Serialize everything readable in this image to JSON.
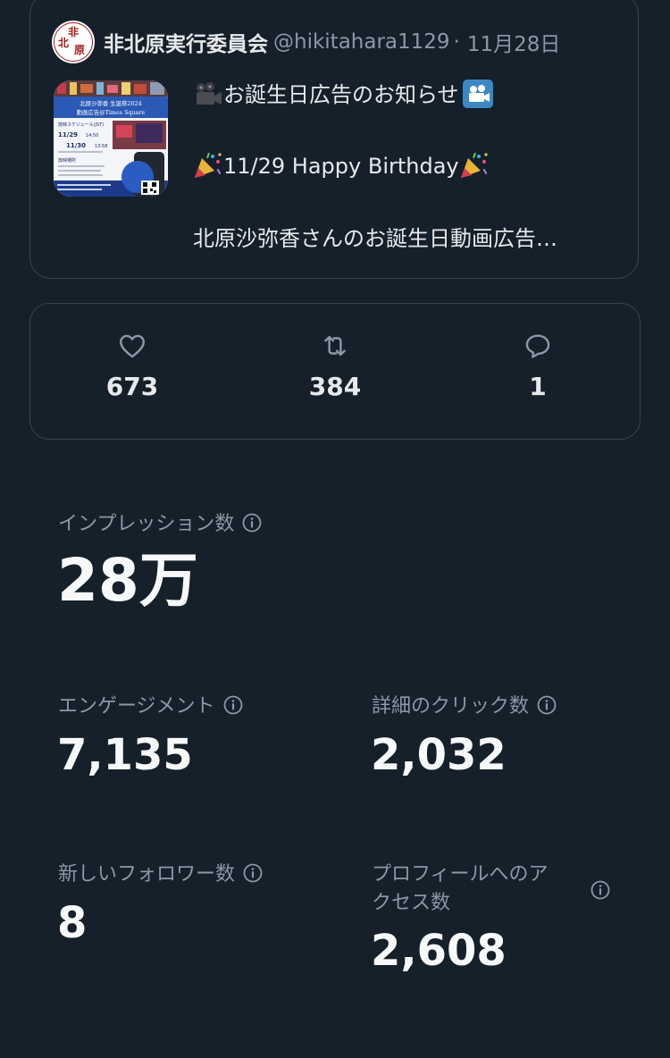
{
  "tweet": {
    "display_name": "非北原実行委員会",
    "handle": "@hikitahara1129",
    "separator": "·",
    "date": "11月28日",
    "avatar_glyphs": [
      "非",
      "北",
      "原"
    ],
    "line1": "お誕生日広告のお知らせ",
    "line2": "11/29 Happy Birthday",
    "line3": "北原沙弥香さんのお誕生日動画広告…",
    "media": {
      "banner_line1": "北原沙弥香 生誕祭2024",
      "banner_line2": "動画広告@Times Square",
      "schedule_title": "放映スケジュール(JST)",
      "date1": "11/29",
      "time1": "14:50",
      "date2": "11/30",
      "time2": "13:58",
      "venue_title": "放映場所"
    }
  },
  "metrics": {
    "likes": "673",
    "retweets": "384",
    "replies": "1"
  },
  "stats": {
    "impressions_label": "インプレッション数",
    "impressions_value": "28万",
    "engagement_label": "エンゲージメント",
    "engagement_value": "7,135",
    "detail_clicks_label": "詳細のクリック数",
    "detail_clicks_value": "2,032",
    "new_followers_label": "新しいフォロワー数",
    "new_followers_value": "8",
    "profile_visits_label_line1": "プロフィールへのア",
    "profile_visits_label_line2": "クセス数",
    "profile_visits_value": "2,608"
  },
  "colors": {
    "background": "#15202b",
    "border": "#38444d",
    "text_primary": "#e7e9ea",
    "text_secondary": "#8b98a5"
  },
  "icons": {
    "like": "heart-icon",
    "retweet": "retweet-icon",
    "reply": "reply-bubble-icon",
    "info": "info-circle-icon",
    "camera": "movie-camera-icon",
    "cinema": "cinema-icon",
    "party": "party-popper-icon"
  }
}
